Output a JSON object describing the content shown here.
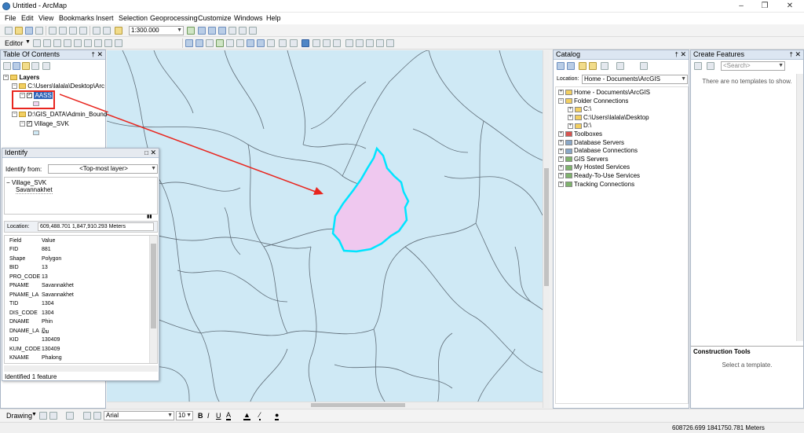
{
  "window": {
    "title": "Untitled - ArcMap"
  },
  "menu": [
    "File",
    "Edit",
    "View",
    "Bookmarks",
    "Insert",
    "Selection",
    "Geoprocessing",
    "Customize",
    "Windows",
    "Help"
  ],
  "toolbar": {
    "scale": "1:300.000",
    "editor_label": "Editor"
  },
  "toc": {
    "title": "Table Of Contents",
    "root": "Layers",
    "group1": "C:\\Users\\lalala\\Desktop\\Arc",
    "layer1": "AASS",
    "group2": "D:\\GIS_DATA\\Admin_Bound",
    "layer2": "Village_SVK"
  },
  "identify": {
    "title": "Identify",
    "from_label": "Identify from:",
    "from_value": "<Top-most layer>",
    "tree_layer": "Village_SVK",
    "tree_feature": "Savannakhet",
    "location_label": "Location:",
    "location_value": "609,488.701  1,847,910.293 Meters",
    "col_field": "Field",
    "col_value": "Value",
    "rows": [
      {
        "f": "FID",
        "v": "881"
      },
      {
        "f": "Shape",
        "v": "Polygon"
      },
      {
        "f": "BID",
        "v": "13"
      },
      {
        "f": "PRO_CODE",
        "v": "13"
      },
      {
        "f": "PNAME",
        "v": "Savannakhet"
      },
      {
        "f": "PNAME_LA",
        "v": "Savannakhet"
      },
      {
        "f": "TID",
        "v": "1304"
      },
      {
        "f": "DIS_CODE",
        "v": "1304"
      },
      {
        "f": "DNAME",
        "v": "Phin"
      },
      {
        "f": "DNAME_LA",
        "v": "ພິນ"
      },
      {
        "f": "KID",
        "v": "130409"
      },
      {
        "f": "KUM_CODE",
        "v": "130409"
      },
      {
        "f": "KNAME",
        "v": "Phalong"
      }
    ],
    "footer": "Identified 1 feature"
  },
  "catalog": {
    "title": "Catalog",
    "location_label": "Location:",
    "location_value": "Home - Documents\\ArcGIS",
    "items": [
      {
        "label": "Home - Documents\\ArcGIS",
        "indent": 0,
        "kind": "folder"
      },
      {
        "label": "Folder Connections",
        "indent": 0,
        "kind": "folder"
      },
      {
        "label": "C:\\",
        "indent": 1,
        "kind": "folder"
      },
      {
        "label": "C:\\Users\\lalala\\Desktop",
        "indent": 1,
        "kind": "folder"
      },
      {
        "label": "D:\\",
        "indent": 1,
        "kind": "folder"
      },
      {
        "label": "Toolboxes",
        "indent": 0,
        "kind": "tool"
      },
      {
        "label": "Database Servers",
        "indent": 0,
        "kind": "db"
      },
      {
        "label": "Database Connections",
        "indent": 0,
        "kind": "db"
      },
      {
        "label": "GIS Servers",
        "indent": 0,
        "kind": "srv"
      },
      {
        "label": "My Hosted Services",
        "indent": 0,
        "kind": "srv"
      },
      {
        "label": "Ready-To-Use Services",
        "indent": 0,
        "kind": "srv"
      },
      {
        "label": "Tracking Connections",
        "indent": 0,
        "kind": "srv"
      }
    ]
  },
  "create_features": {
    "title": "Create Features",
    "search_placeholder": "<Search>",
    "empty_text": "There are no templates to show.",
    "construction_title": "Construction Tools",
    "construction_text": "Select a template."
  },
  "drawing": {
    "label": "Drawing",
    "font": "Arial",
    "size": "10"
  },
  "status": {
    "coords": "608726.699  1841750.781 Meters"
  },
  "colors": {
    "water": "#cfe9f5",
    "selection": "#00e5ff",
    "highlight_fill": "#efc8ef",
    "annotation": "#e8261f"
  }
}
